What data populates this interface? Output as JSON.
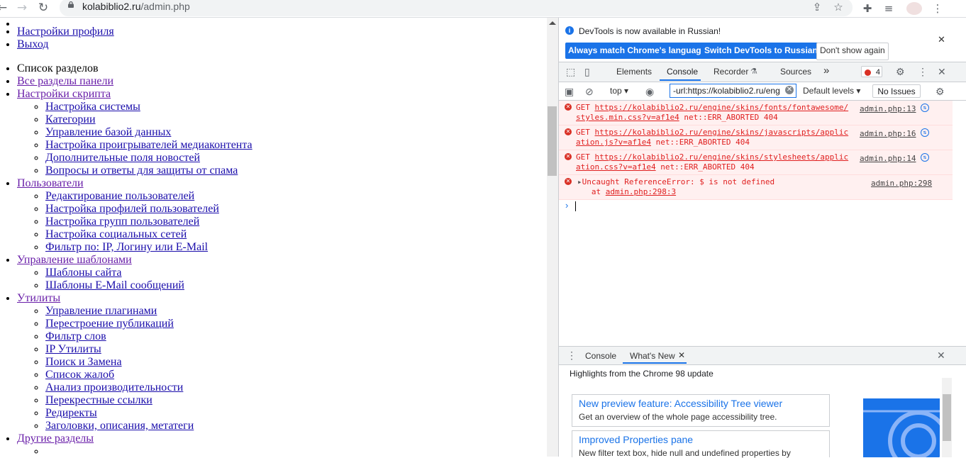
{
  "browser": {
    "url_host": "kolabiblio2.ru",
    "url_path": "/admin.php"
  },
  "page": {
    "top_links": [
      "Настройки профиля",
      "Выход"
    ],
    "sections_heading": "Список разделов",
    "nav": [
      {
        "label": "Все разделы панели",
        "items": []
      },
      {
        "label": "Настройки скрипта",
        "items": [
          "Настройка системы",
          "Категории",
          "Управление базой данных",
          "Настройка проигрывателей медиаконтента",
          "Дополнительные поля новостей",
          "Вопросы и ответы для защиты от спама"
        ]
      },
      {
        "label": "Пользователи",
        "items": [
          "Редактирование пользователей",
          "Настройка профилей пользователей",
          "Настройка групп пользователей",
          "Настройка социальных сетей",
          "Фильтр по: IP, Логину или E-Mail"
        ]
      },
      {
        "label": "Управление шаблонами",
        "items": [
          "Шаблоны сайта",
          "Шаблоны E-Mail сообщений"
        ]
      },
      {
        "label": "Утилиты",
        "items": [
          "Управление плагинами",
          "Перестроение публикаций",
          "Фильтр слов",
          "IP Утилиты",
          "Поиск и Замена",
          "Список жалоб",
          "Анализ производительности",
          "Перекрестные ссылки",
          "Редиректы",
          "Заголовки, описания, метатеги"
        ]
      },
      {
        "label": "Другие разделы",
        "items": []
      }
    ]
  },
  "devtools": {
    "infobar": {
      "text": "DevTools is now available in Russian!",
      "btn_match": "Always match Chrome's language",
      "btn_switch": "Switch DevTools to Russian",
      "btn_dont_show": "Don't show again"
    },
    "tabs": {
      "elements": "Elements",
      "console": "Console",
      "recorder": "Recorder",
      "sources": "Sources",
      "more": "»"
    },
    "error_count": "4",
    "toolbar": {
      "context": "top",
      "filter_value": "-url:https://kolabiblio2.ru/eng",
      "levels": "Default levels",
      "issues": "No Issues"
    },
    "messages": [
      {
        "method": "GET",
        "url": "https://kolabiblio2.ru/engine/skins/fonts/fontawesome/styles.min.css?v=af1e4",
        "error": "net::ERR_ABORTED 404",
        "source": "admin.php:13"
      },
      {
        "method": "GET",
        "url": "https://kolabiblio2.ru/engine/skins/javascripts/application.js?v=af1e4",
        "error": "net::ERR_ABORTED 404",
        "source": "admin.php:16"
      },
      {
        "method": "GET",
        "url": "https://kolabiblio2.ru/engine/skins/stylesheets/application.css?v=af1e4",
        "error": "net::ERR_ABORTED 404",
        "source": "admin.php:14"
      }
    ],
    "exception": {
      "text": "Uncaught ReferenceError: $ is not defined",
      "at_prefix": "at",
      "at_link": "admin.php:298:3",
      "source": "admin.php:298"
    },
    "drawer": {
      "tab_console": "Console",
      "tab_whatsnew": "What's New",
      "highlights": "Highlights from the Chrome 98 update",
      "cards": [
        {
          "title": "New preview feature: Accessibility Tree viewer",
          "desc": "Get an overview of the whole page accessibility tree."
        },
        {
          "title": "Improved Properties pane",
          "desc": "New filter text box, hide null and undefined properties by"
        }
      ]
    }
  }
}
